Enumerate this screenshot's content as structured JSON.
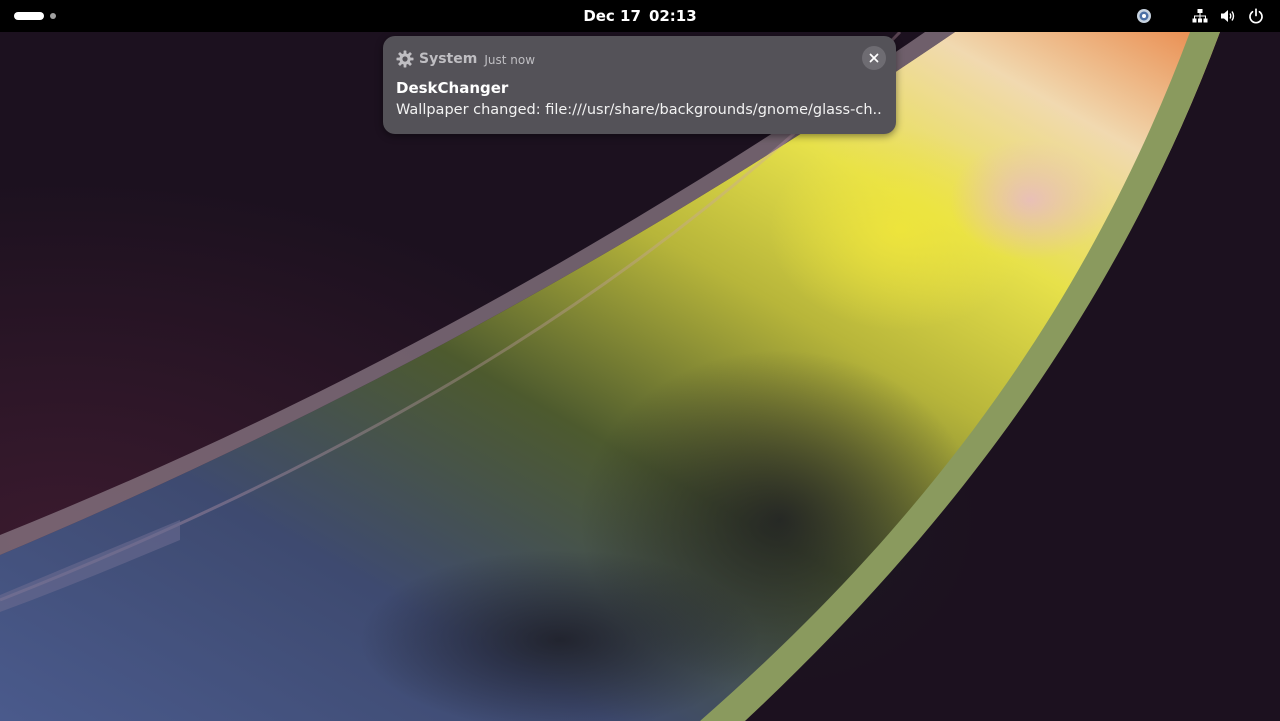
{
  "topbar": {
    "clock": {
      "date": "Dec 17",
      "time": "02:13"
    },
    "workspaces": {
      "count": 2,
      "active_index": 0
    },
    "tray_icons": [
      "extension-icon",
      "network-wired-icon",
      "volume-icon",
      "power-icon"
    ]
  },
  "notification": {
    "app_name": "System",
    "app_icon": "gear-icon",
    "time": "Just now",
    "title": "DeskChanger",
    "body": "Wallpaper changed: file:///usr/share/backgrounds/gnome/glass-ch...",
    "close_icon": "close-icon"
  },
  "colors": {
    "topbar_bg": "#000000",
    "desktop_bg": "#1c111f",
    "notification_bg": "#545258",
    "ring_green": "#8a9a5e"
  }
}
